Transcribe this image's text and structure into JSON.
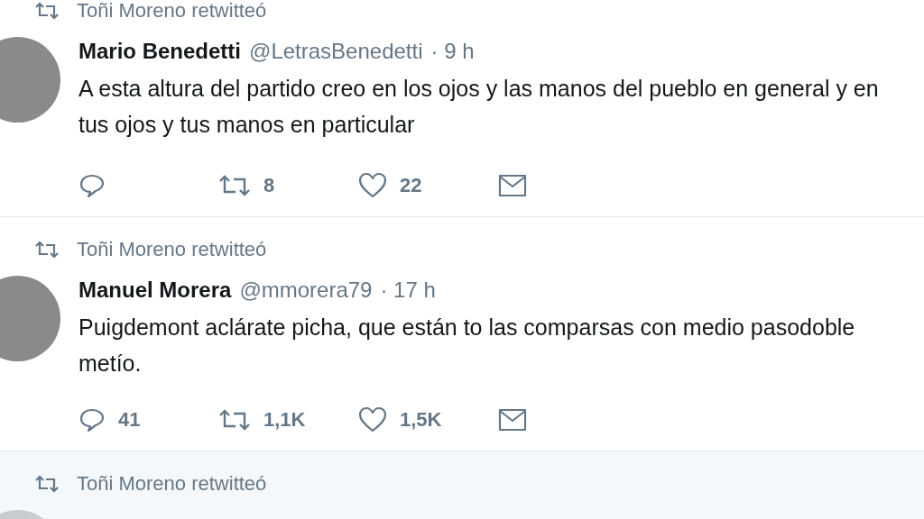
{
  "tweets": [
    {
      "retweeted_by": "Toñi Moreno retwitteó",
      "highlighted": false,
      "name": "Mario Benedetti",
      "handle": "@LetrasBenedetti",
      "time": "· 9 h",
      "text": "A esta altura del partido creo en los ojos y las manos del pueblo en general y en tus ojos y tus manos en particular",
      "retweets": "8",
      "likes": "22"
    },
    {
      "retweeted_by": "Toñi Moreno retwitteó",
      "highlighted": false,
      "name": "Manuel Morera",
      "handle": "@mmorera79",
      "time": "· 17 h",
      "text": "Puigdemont aclárate picha, que están to las comparsas con medio pasodoble metío.",
      "replies": "41",
      "retweets": "1,1K",
      "likes": "1,5K"
    },
    {
      "retweeted_by": "Toñi Moreno retwitteó",
      "highlighted": true
    }
  ]
}
